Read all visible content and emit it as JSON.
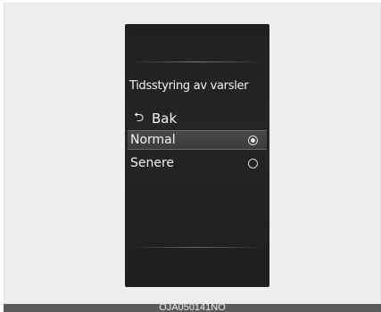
{
  "menu": {
    "title": "Tidsstyring av varsler",
    "back_label": "Bak",
    "back_arrow": "⮌",
    "options": [
      {
        "label": "Normal",
        "selected": true
      },
      {
        "label": "Senere",
        "selected": false
      }
    ]
  },
  "caption": "OJA050141NO"
}
